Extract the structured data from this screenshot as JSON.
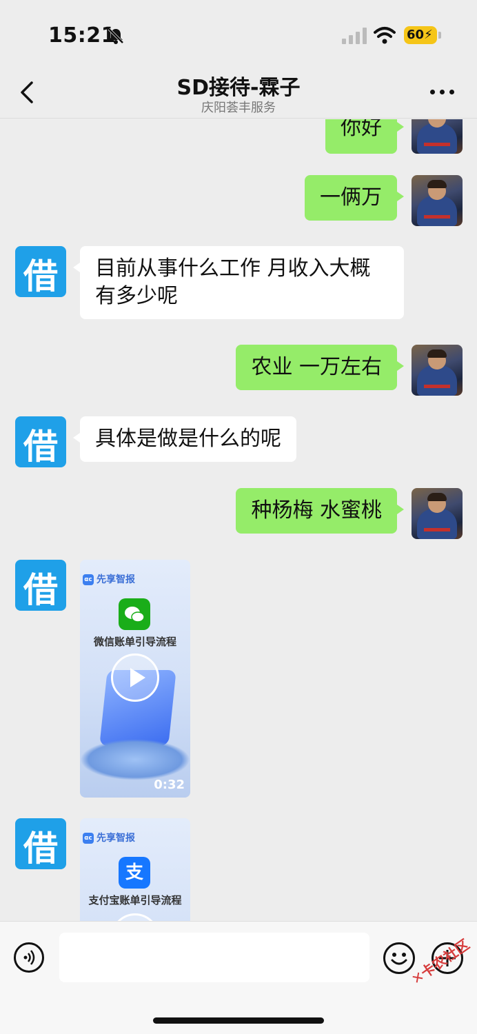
{
  "status": {
    "time": "15:21",
    "battery": "60"
  },
  "nav": {
    "title": "SD接待-霖子",
    "subtitle": "庆阳荟丰服务"
  },
  "messages": [
    {
      "from": "me",
      "text": "你好"
    },
    {
      "from": "me",
      "text": "一俩万"
    },
    {
      "from": "them",
      "text": "目前从事什么工作 月收入大概有多少呢"
    },
    {
      "from": "me",
      "text": "农业 一万左右"
    },
    {
      "from": "them",
      "text": "具体是做是什么的呢"
    },
    {
      "from": "me",
      "text": "种杨梅 水蜜桃"
    }
  ],
  "videos": [
    {
      "brand": "先享智报",
      "app_icon": "wechat-icon",
      "title": "微信账单引导流程",
      "duration": "0:32"
    },
    {
      "brand": "先享智报",
      "app_icon": "alipay-icon",
      "app_glyph": "支",
      "title": "支付宝账单引导流程"
    }
  ],
  "bot_avatar_glyph": "借",
  "input": {
    "value": ""
  },
  "watermark": "卡农社区",
  "colors": {
    "my_bubble": "#95ec69",
    "their_bubble": "#ffffff",
    "bot_avatar": "#1fa0e8",
    "background": "#ededed"
  }
}
